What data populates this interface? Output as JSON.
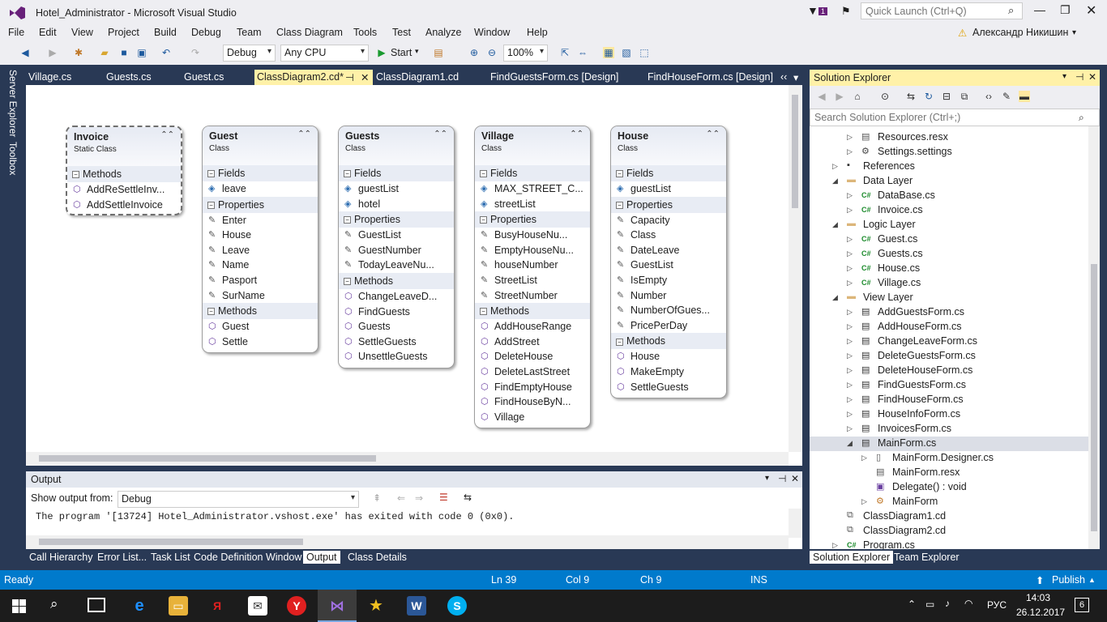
{
  "window": {
    "title": "Hotel_Administrator - Microsoft Visual Studio",
    "quick_launch_placeholder": "Quick Launch (Ctrl+Q)",
    "notif_count": "1",
    "user": "Александр Никишин"
  },
  "menu": [
    "File",
    "Edit",
    "View",
    "Project",
    "Build",
    "Debug",
    "Team",
    "Class Diagram",
    "Tools",
    "Test",
    "Analyze",
    "Window",
    "Help"
  ],
  "toolbar": {
    "config": "Debug",
    "platform": "Any CPU",
    "start": "Start",
    "zoom": "100%"
  },
  "side_tools": {
    "server_explorer": "Server Explorer",
    "toolbox": "Toolbox"
  },
  "tabs": [
    "Village.cs",
    "Guests.cs",
    "Guest.cs",
    "ClassDiagram2.cd*",
    "ClassDiagram1.cd",
    "FindGuestsForm.cs [Design]",
    "FindHouseForm.cs [Design]"
  ],
  "classes": [
    {
      "name": "Invoice",
      "kind": "Static Class",
      "sections": [
        {
          "title": "Methods",
          "items": [
            "AddReSettleInv...",
            "AddSettleInvoice"
          ]
        }
      ]
    },
    {
      "name": "Guest",
      "kind": "Class",
      "sections": [
        {
          "title": "Fields",
          "items": [
            "leave"
          ]
        },
        {
          "title": "Properties",
          "items": [
            "Enter",
            "House",
            "Leave",
            "Name",
            "Pasport",
            "SurName"
          ]
        },
        {
          "title": "Methods",
          "items": [
            "Guest",
            "Settle"
          ]
        }
      ]
    },
    {
      "name": "Guests",
      "kind": "Class",
      "sections": [
        {
          "title": "Fields",
          "items": [
            "guestList",
            "hotel"
          ]
        },
        {
          "title": "Properties",
          "items": [
            "GuestList",
            "GuestNumber",
            "TodayLeaveNu..."
          ]
        },
        {
          "title": "Methods",
          "items": [
            "ChangeLeaveD...",
            "FindGuests",
            "Guests",
            "SettleGuests",
            "UnsettleGuests"
          ]
        }
      ]
    },
    {
      "name": "Village",
      "kind": "Class",
      "sections": [
        {
          "title": "Fields",
          "items": [
            "MAX_STREET_C...",
            "streetList"
          ]
        },
        {
          "title": "Properties",
          "items": [
            "BusyHouseNu...",
            "EmptyHouseNu...",
            "houseNumber",
            "StreetList",
            "StreetNumber"
          ]
        },
        {
          "title": "Methods",
          "items": [
            "AddHouseRange",
            "AddStreet",
            "DeleteHouse",
            "DeleteLastStreet",
            "FindEmptyHouse",
            "FindHouseByN...",
            "Village"
          ]
        }
      ]
    },
    {
      "name": "House",
      "kind": "Class",
      "sections": [
        {
          "title": "Fields",
          "items": [
            "guestList"
          ]
        },
        {
          "title": "Properties",
          "items": [
            "Capacity",
            "Class",
            "DateLeave",
            "GuestList",
            "IsEmpty",
            "Number",
            "NumberOfGues...",
            "PricePerDay"
          ]
        },
        {
          "title": "Methods",
          "items": [
            "House",
            "MakeEmpty",
            "SettleGuests"
          ]
        }
      ]
    }
  ],
  "output": {
    "title": "Output",
    "show_from_label": "Show output from:",
    "source": "Debug",
    "text": "The program '[13724] Hotel_Administrator.vshost.exe' has exited with code 0 (0x0)."
  },
  "bottom_tabs": [
    "Call Hierarchy",
    "Error List...",
    "Task List",
    "Code Definition Window",
    "Output",
    "Class Details"
  ],
  "solution_explorer": {
    "title": "Solution Explorer",
    "search_placeholder": "Search Solution Explorer (Ctrl+;)",
    "items": [
      {
        "label": "Resources.resx",
        "icon": "resx-icon",
        "exp": "▷"
      },
      {
        "label": "Settings.settings",
        "icon": "gear-icon",
        "exp": "▷"
      },
      {
        "label": "References",
        "icon": "references-icon",
        "exp": "▷"
      },
      {
        "label": "Data Layer",
        "icon": "folder-icon",
        "exp": "◢"
      },
      {
        "label": "DataBase.cs",
        "icon": "cs-icon",
        "exp": "▷"
      },
      {
        "label": "Invoice.cs",
        "icon": "cs-icon",
        "exp": "▷"
      },
      {
        "label": "Logic Layer",
        "icon": "folder-icon",
        "exp": "◢"
      },
      {
        "label": "Guest.cs",
        "icon": "cs-icon",
        "exp": "▷"
      },
      {
        "label": "Guests.cs",
        "icon": "cs-icon",
        "exp": "▷"
      },
      {
        "label": "House.cs",
        "icon": "cs-icon",
        "exp": "▷"
      },
      {
        "label": "Village.cs",
        "icon": "cs-icon",
        "exp": "▷"
      },
      {
        "label": "View Layer",
        "icon": "folder-icon",
        "exp": "◢"
      },
      {
        "label": "AddGuestsForm.cs",
        "icon": "form-icon",
        "exp": "▷"
      },
      {
        "label": "AddHouseForm.cs",
        "icon": "form-icon",
        "exp": "▷"
      },
      {
        "label": "ChangeLeaveForm.cs",
        "icon": "form-icon",
        "exp": "▷"
      },
      {
        "label": "DeleteGuestsForm.cs",
        "icon": "form-icon",
        "exp": "▷"
      },
      {
        "label": "DeleteHouseForm.cs",
        "icon": "form-icon",
        "exp": "▷"
      },
      {
        "label": "FindGuestsForm.cs",
        "icon": "form-icon",
        "exp": "▷"
      },
      {
        "label": "FindHouseForm.cs",
        "icon": "form-icon",
        "exp": "▷"
      },
      {
        "label": "HouseInfoForm.cs",
        "icon": "form-icon",
        "exp": "▷"
      },
      {
        "label": "InvoicesForm.cs",
        "icon": "form-icon",
        "exp": "▷"
      },
      {
        "label": "MainForm.cs",
        "icon": "form-icon",
        "exp": "◢"
      },
      {
        "label": "MainForm.Designer.cs",
        "icon": "cs-file-icon",
        "exp": "▷"
      },
      {
        "label": "MainForm.resx",
        "icon": "resx-icon",
        "exp": ""
      },
      {
        "label": "Delegate() : void",
        "icon": "delegate-icon",
        "exp": ""
      },
      {
        "label": "MainForm",
        "icon": "class-icon",
        "exp": "▷"
      },
      {
        "label": "ClassDiagram1.cd",
        "icon": "diagram-icon",
        "exp": ""
      },
      {
        "label": "ClassDiagram2.cd",
        "icon": "diagram-icon",
        "exp": ""
      },
      {
        "label": "Program.cs",
        "icon": "cs-icon",
        "exp": "▷"
      }
    ],
    "tabs": [
      "Solution Explorer",
      "Team Explorer"
    ]
  },
  "status": {
    "state": "Ready",
    "ln": "Ln 39",
    "col": "Col 9",
    "ch": "Ch 9",
    "ins": "INS",
    "publish": "Publish"
  },
  "taskbar": {
    "lang": "РУС",
    "time": "14:03",
    "date": "26.12.2017",
    "notif": "6"
  }
}
